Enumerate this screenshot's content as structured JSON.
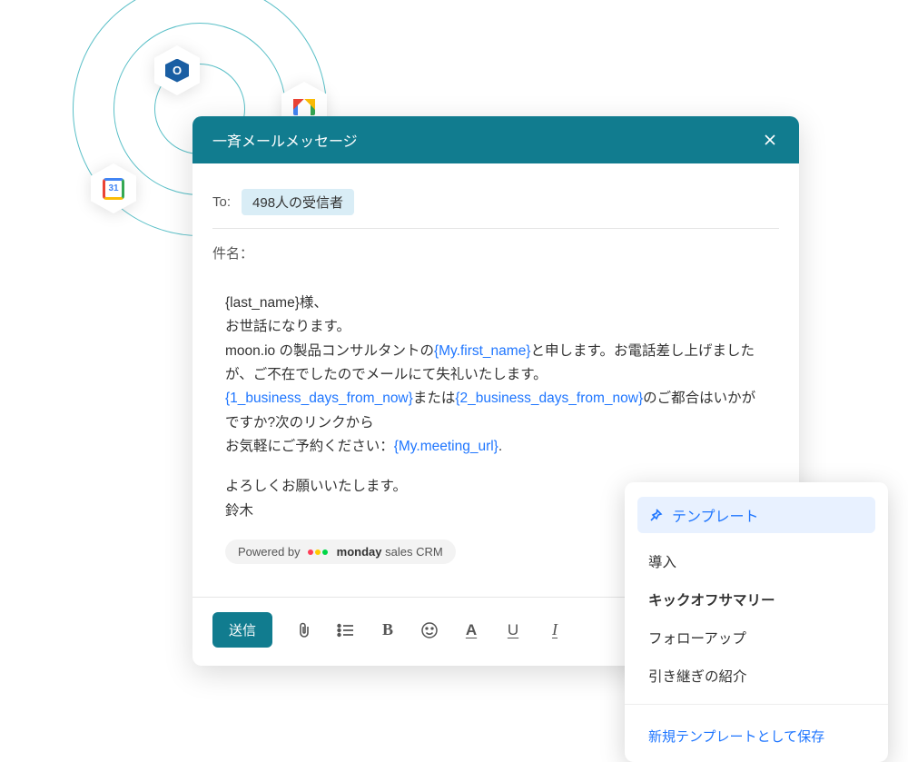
{
  "orbit_icons": {
    "outlook_letter": "O",
    "gcal_day": "31"
  },
  "compose": {
    "title": "一斉メールメッセージ",
    "to_label": "To:",
    "recipients_chip": "498人の受信者",
    "subject_label": "件名：",
    "body": {
      "line1_pre": "{last_name}様、",
      "line2": "お世話になります。",
      "line3_pre": "moon.io の製品コンサルタントの",
      "token_firstname": "{My.first_name}",
      "line3_post": "と申します。お電話差し上げましたが、ご不在でしたのでメールにて失礼いたします。",
      "token_1bd": "{1_business_days_from_now}",
      "line4_mid": "または",
      "token_2bd": "{2_business_days_from_now}",
      "line4_post": "のご都合はいかがですか?次のリンクから",
      "line5_pre": "お気軽にご予約ください：",
      "token_meeting": "{My.meeting_url}",
      "line5_post": ".",
      "line6": "よろしくお願いいたします。",
      "line7": "鈴木"
    },
    "powered_prefix": "Powered by",
    "powered_brand": "monday",
    "powered_suffix": " sales CRM",
    "send_label": "送信"
  },
  "templates": {
    "header": "テンプレート",
    "items": [
      {
        "label": "導入",
        "selected": false
      },
      {
        "label": "キックオフサマリー",
        "selected": true
      },
      {
        "label": "フォローアップ",
        "selected": false
      },
      {
        "label": "引き継ぎの紹介",
        "selected": false
      }
    ],
    "save_new": "新規テンプレートとして保存"
  }
}
